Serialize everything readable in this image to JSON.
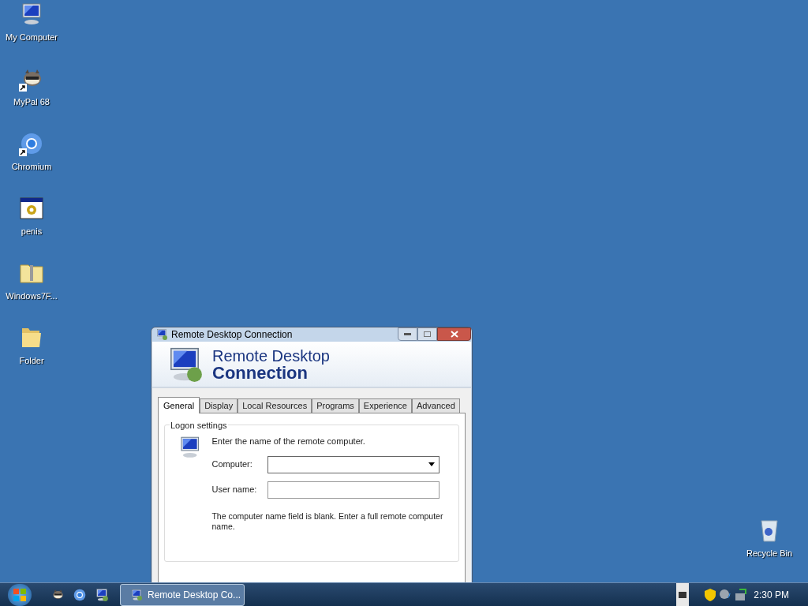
{
  "desktop": {
    "icons": [
      {
        "label": "My Computer",
        "kind": "computer",
        "shortcut": false
      },
      {
        "label": "MyPal 68",
        "kind": "raccoon",
        "shortcut": true
      },
      {
        "label": "Chromium",
        "kind": "chromium",
        "shortcut": true
      },
      {
        "label": "penis",
        "kind": "app",
        "shortcut": false
      },
      {
        "label": "Windows7F...",
        "kind": "zip",
        "shortcut": false
      },
      {
        "label": "Folder",
        "kind": "folder",
        "shortcut": false
      }
    ],
    "recycle_bin": {
      "label": "Recycle Bin"
    }
  },
  "window": {
    "title": "Remote Desktop Connection",
    "banner_line1": "Remote Desktop",
    "banner_line2": "Connection",
    "tabs": [
      {
        "label": "General",
        "selected": true
      },
      {
        "label": "Display",
        "selected": false
      },
      {
        "label": "Local Resources",
        "selected": false
      },
      {
        "label": "Programs",
        "selected": false
      },
      {
        "label": "Experience",
        "selected": false
      },
      {
        "label": "Advanced",
        "selected": false
      }
    ],
    "group": "Logon settings",
    "prompt": "Enter the name of the remote computer.",
    "fields": [
      {
        "label": "Computer:",
        "kind": "combo"
      },
      {
        "label": "User name:",
        "kind": "text"
      }
    ],
    "note": "The computer name field is blank. Enter a full remote computer name."
  },
  "taskbar": {
    "pinned": [
      {
        "kind": "raccoon"
      },
      {
        "kind": "chromium"
      },
      {
        "kind": "remote"
      }
    ],
    "tasks": [
      {
        "label": "Remote Desktop Co...",
        "selected": true
      }
    ],
    "clock": "2:30 PM"
  }
}
